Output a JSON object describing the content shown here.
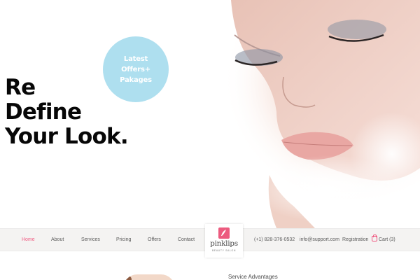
{
  "hero": {
    "headline": [
      "Re",
      "Define",
      "Your Look."
    ],
    "promo": [
      "Latest",
      "Offers+",
      "Pakages"
    ]
  },
  "nav": {
    "items": [
      {
        "label": "Home",
        "active": true
      },
      {
        "label": "About"
      },
      {
        "label": "Services"
      },
      {
        "label": "Pricing"
      },
      {
        "label": "Offers"
      },
      {
        "label": "Contact"
      }
    ],
    "phone": "(+1) 828-376-0532",
    "email": "info@support.com",
    "registration": "Registration",
    "cart": "Cart (3)"
  },
  "logo": {
    "name": "pinklips",
    "tagline": "BEAUTY SALON"
  },
  "section": {
    "title": "Service Advantages"
  },
  "colors": {
    "accent": "#f05b83",
    "promo_bg": "#aedfef",
    "nav_bg": "#f4f3f2",
    "text": "#070707"
  }
}
